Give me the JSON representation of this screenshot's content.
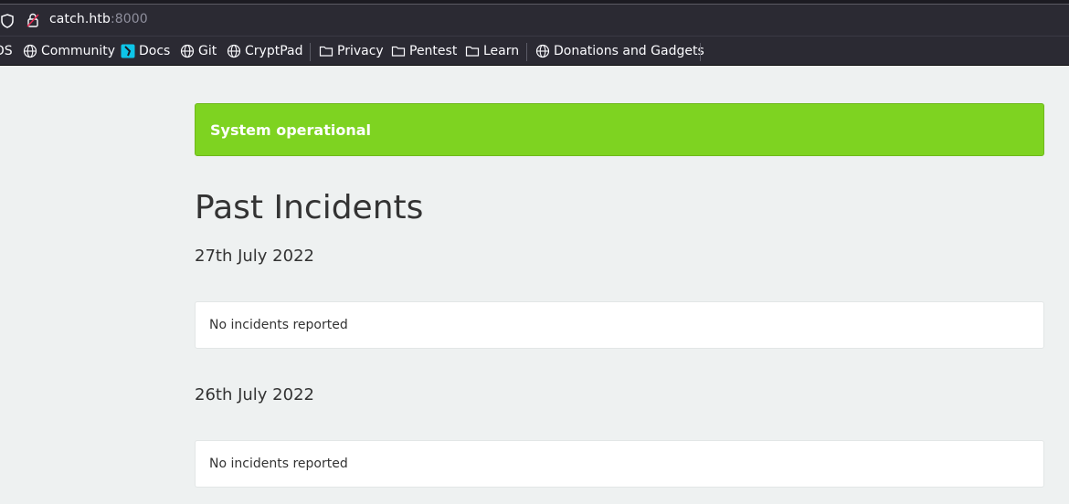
{
  "browser": {
    "url_host": "catch.htb",
    "url_port": ":8000",
    "bookmarks": [
      {
        "label": "DS",
        "icon": "partial-bookmark"
      },
      {
        "label": "Community",
        "icon": "globe-icon"
      },
      {
        "label": "Docs",
        "icon": "docs-icon"
      },
      {
        "label": "Git",
        "icon": "globe-icon"
      },
      {
        "label": "CryptPad",
        "icon": "globe-icon"
      },
      {
        "label": "Privacy",
        "icon": "folder-icon"
      },
      {
        "label": "Pentest",
        "icon": "folder-icon"
      },
      {
        "label": "Learn",
        "icon": "folder-icon"
      },
      {
        "label": "Donations and Gadgets",
        "icon": "globe-icon"
      }
    ]
  },
  "status": {
    "text": "System operational",
    "color": "#7ed321"
  },
  "incidents": {
    "title": "Past Incidents",
    "days": [
      {
        "date": "27th July 2022",
        "message": "No incidents reported"
      },
      {
        "date": "26th July 2022",
        "message": "No incidents reported"
      }
    ]
  }
}
